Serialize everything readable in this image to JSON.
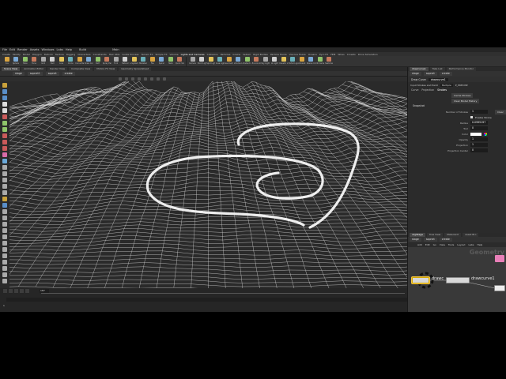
{
  "menubar": {
    "items": [
      "File",
      "Edit",
      "Render",
      "Assets",
      "Windows",
      "Labs",
      "Help"
    ],
    "desktop": "Build",
    "context": "Main"
  },
  "shelf_tabs": [
    "Create",
    "Modify",
    "Model",
    "Polygon",
    "Deform",
    "Texture",
    "Rigging",
    "Characters",
    "Constraints",
    "Hair Utils",
    "Guide Process",
    "Terrain FX",
    "Simple FX",
    "Volume",
    "Lights and Cameras",
    "Collisions",
    "Particles",
    "Grains",
    "Vellum",
    "Rigid Bodies",
    "Particle Fluids",
    "Viscous Fluids",
    "Oceans",
    "Pyro FX",
    "FEM",
    "Wires",
    "Crowds",
    "Drive Simulation"
  ],
  "shelf_tools": [
    "Box",
    "Sphere",
    "Tube",
    "Torus",
    "Grid",
    "Null",
    "Line",
    "Circle",
    "Curve Bezier",
    "Draw Curve",
    "Path",
    "Spray Paint",
    "Font",
    "Platonic",
    "L-System",
    "Metaball",
    "File",
    "Spiral",
    "Helix",
    "Quick Shapes",
    "Camera",
    "Point Light",
    "Spot Light",
    "Area Light",
    "Geometry Light",
    "Volume Light",
    "Distant Light",
    "Environment Light",
    "Sky Light",
    "GI Light",
    "Caustic Light",
    "Portal Light",
    "Ambient Light",
    "Stereo Camera",
    "VR Camera",
    "Switcher"
  ],
  "pane_tabs": [
    "Scene View",
    "Animation Editor",
    "Render View",
    "Composite View",
    "Motion FX View",
    "Geometry Spreadsheet"
  ],
  "path": {
    "root": "obj",
    "stage": "stage",
    "node1": "sopnet1",
    "node2": "sopnet",
    "node3": "create"
  },
  "timeline": {
    "frame": "187",
    "start": "1",
    "end1": "240",
    "end2": "240",
    "keys_label": "0 keys, 0/0 channels",
    "key_all_label": "Key All Channels",
    "auto_update": "Auto Update"
  },
  "right_panel": {
    "tabs": [
      "drawcurve1",
      "Take List",
      "Performance Monitor"
    ],
    "path": {
      "stage": "stage",
      "sopnet": "sopnet",
      "node": "create"
    },
    "node_type": "Draw Curve",
    "node_name": "drawcurve1",
    "toolbar": {
      "label1": "Input Strokes and Paint",
      "field1": "Multiple",
      "label2": "P_PRECISE"
    },
    "subtabs": [
      "Curve",
      "Projection",
      "Strokes"
    ],
    "buttons": {
      "cache": "Cache Strokes",
      "clear": "Clear Model History"
    },
    "snapshot_label": "Snapshot",
    "num_strokes": {
      "label": "Number of Strokes",
      "value": "1",
      "clear": "Clear"
    },
    "enable_stroke": "Enable Stroke",
    "params": [
      {
        "label": "Radius",
        "value": "0.0995197"
      },
      {
        "label": "Tool",
        "value": "0"
      },
      {
        "label": "Color",
        "value": ""
      },
      {
        "label": "Opacity",
        "value": "1"
      },
      {
        "label": "Projection",
        "value": "1"
      },
      {
        "label": "Projection Center",
        "value": "0"
      }
    ]
  },
  "network": {
    "tabs": [
      "obj/stage",
      "Tree View",
      "Material P",
      "Asset Bro"
    ],
    "path": {
      "stage": "stage",
      "sopnet": "sopnet",
      "node": "create"
    },
    "menu": [
      "Add",
      "Edit",
      "Go",
      "View",
      "Tools",
      "Layout",
      "Labs",
      "Help"
    ],
    "context_label": "Geometry",
    "nodes": [
      {
        "label": "drawc"
      },
      {
        "label": "drawcurve1"
      }
    ]
  },
  "colors": {
    "accent": "#f5c542",
    "bg": "#2b2b2b",
    "wire": "#d9d9d9"
  }
}
